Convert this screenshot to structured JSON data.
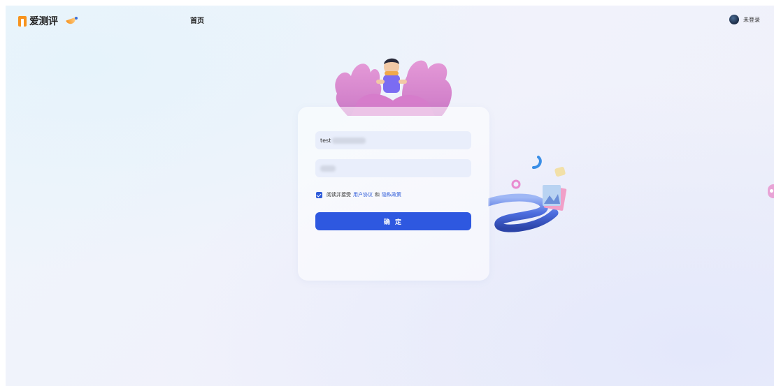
{
  "app": {
    "logo_text": "爱测评"
  },
  "nav": {
    "home": "首页"
  },
  "user": {
    "status": "未登录"
  },
  "login": {
    "username_value": "test",
    "agree_prefix": "阅读并接受",
    "user_agreement": "用户协议",
    "and": "和",
    "privacy_policy": "隐私政策",
    "submit": "确 定",
    "agree_checked": true
  },
  "colors": {
    "primary": "#2e58e0",
    "brand": "#f7931e"
  }
}
